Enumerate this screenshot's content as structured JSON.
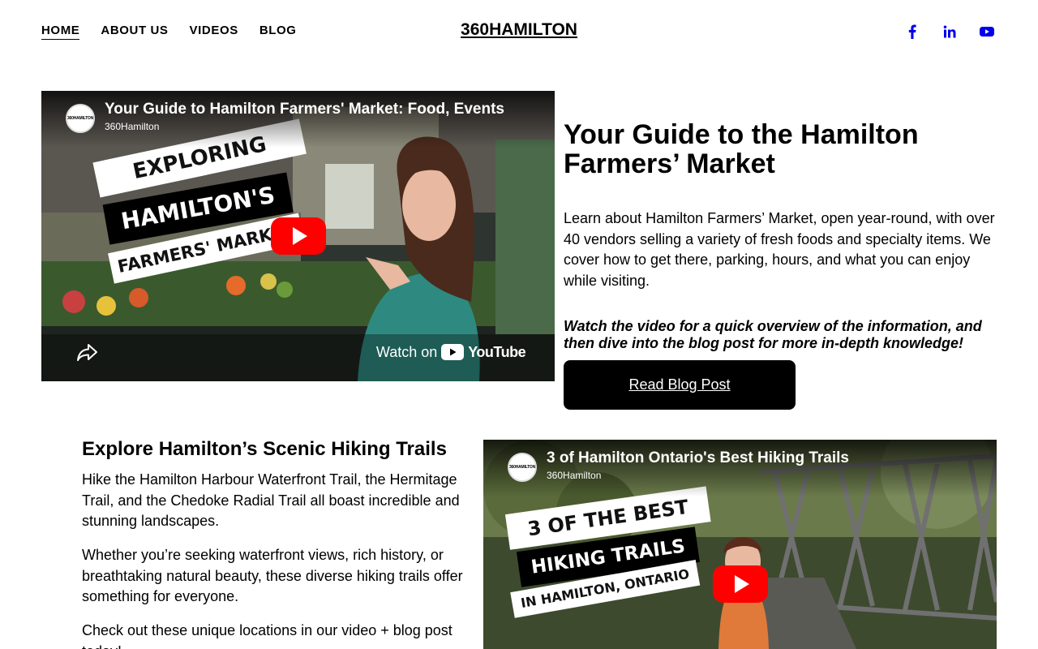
{
  "nav": {
    "items": [
      {
        "label": "HOME"
      },
      {
        "label": "ABOUT US"
      },
      {
        "label": "VIDEOS"
      },
      {
        "label": "BLOG"
      }
    ]
  },
  "brand": {
    "name": "360HAMILTON"
  },
  "social": {
    "icons": [
      "facebook-icon",
      "linkedin-icon",
      "youtube-icon"
    ],
    "color": "#0000ee"
  },
  "section1": {
    "video": {
      "title": "Your Guide to Hamilton Farmers' Market: Food, Events",
      "channel": "360Hamilton",
      "channel_logo_text": "360HAMILTON",
      "banner_line1": "EXPLORING",
      "banner_line2": "HAMILTON'S",
      "banner_line3": "FARMERS' MARKET",
      "watch_on": "Watch on",
      "youtube": "YouTube"
    },
    "heading": "Your Guide to the Hamilton Farmers’ Market",
    "body": "Learn about Hamilton Farmers’ Market, open year-round, with over 40 vendors selling a variety of fresh foods and specialty items. We cover how to get there, parking, hours, and what you can enjoy while visiting.",
    "emphasis": "Watch the video for a quick overview of the information, and then dive into the blog post for more in-depth knowledge!",
    "button_label": "Read Blog Post"
  },
  "section2": {
    "heading": "Explore Hamilton’s Scenic Hiking Trails",
    "paragraphs": [
      "Hike the Hamilton Harbour Waterfront Trail, the Hermitage Trail, and the Chedoke Radial Trail all boast incredible and stunning landscapes.",
      "Whether you’re seeking waterfront views, rich history, or breathtaking natural beauty, these diverse hiking trails offer something for everyone.",
      "Check out these unique locations in our video + blog post today!"
    ],
    "video": {
      "title": "3 of Hamilton Ontario's Best Hiking Trails",
      "channel": "360Hamilton",
      "channel_logo_text": "360HAMILTON",
      "banner_line1": "3 OF THE BEST",
      "banner_line2": "HIKING TRAILS",
      "banner_line3": "IN HAMILTON, ONTARIO"
    }
  }
}
